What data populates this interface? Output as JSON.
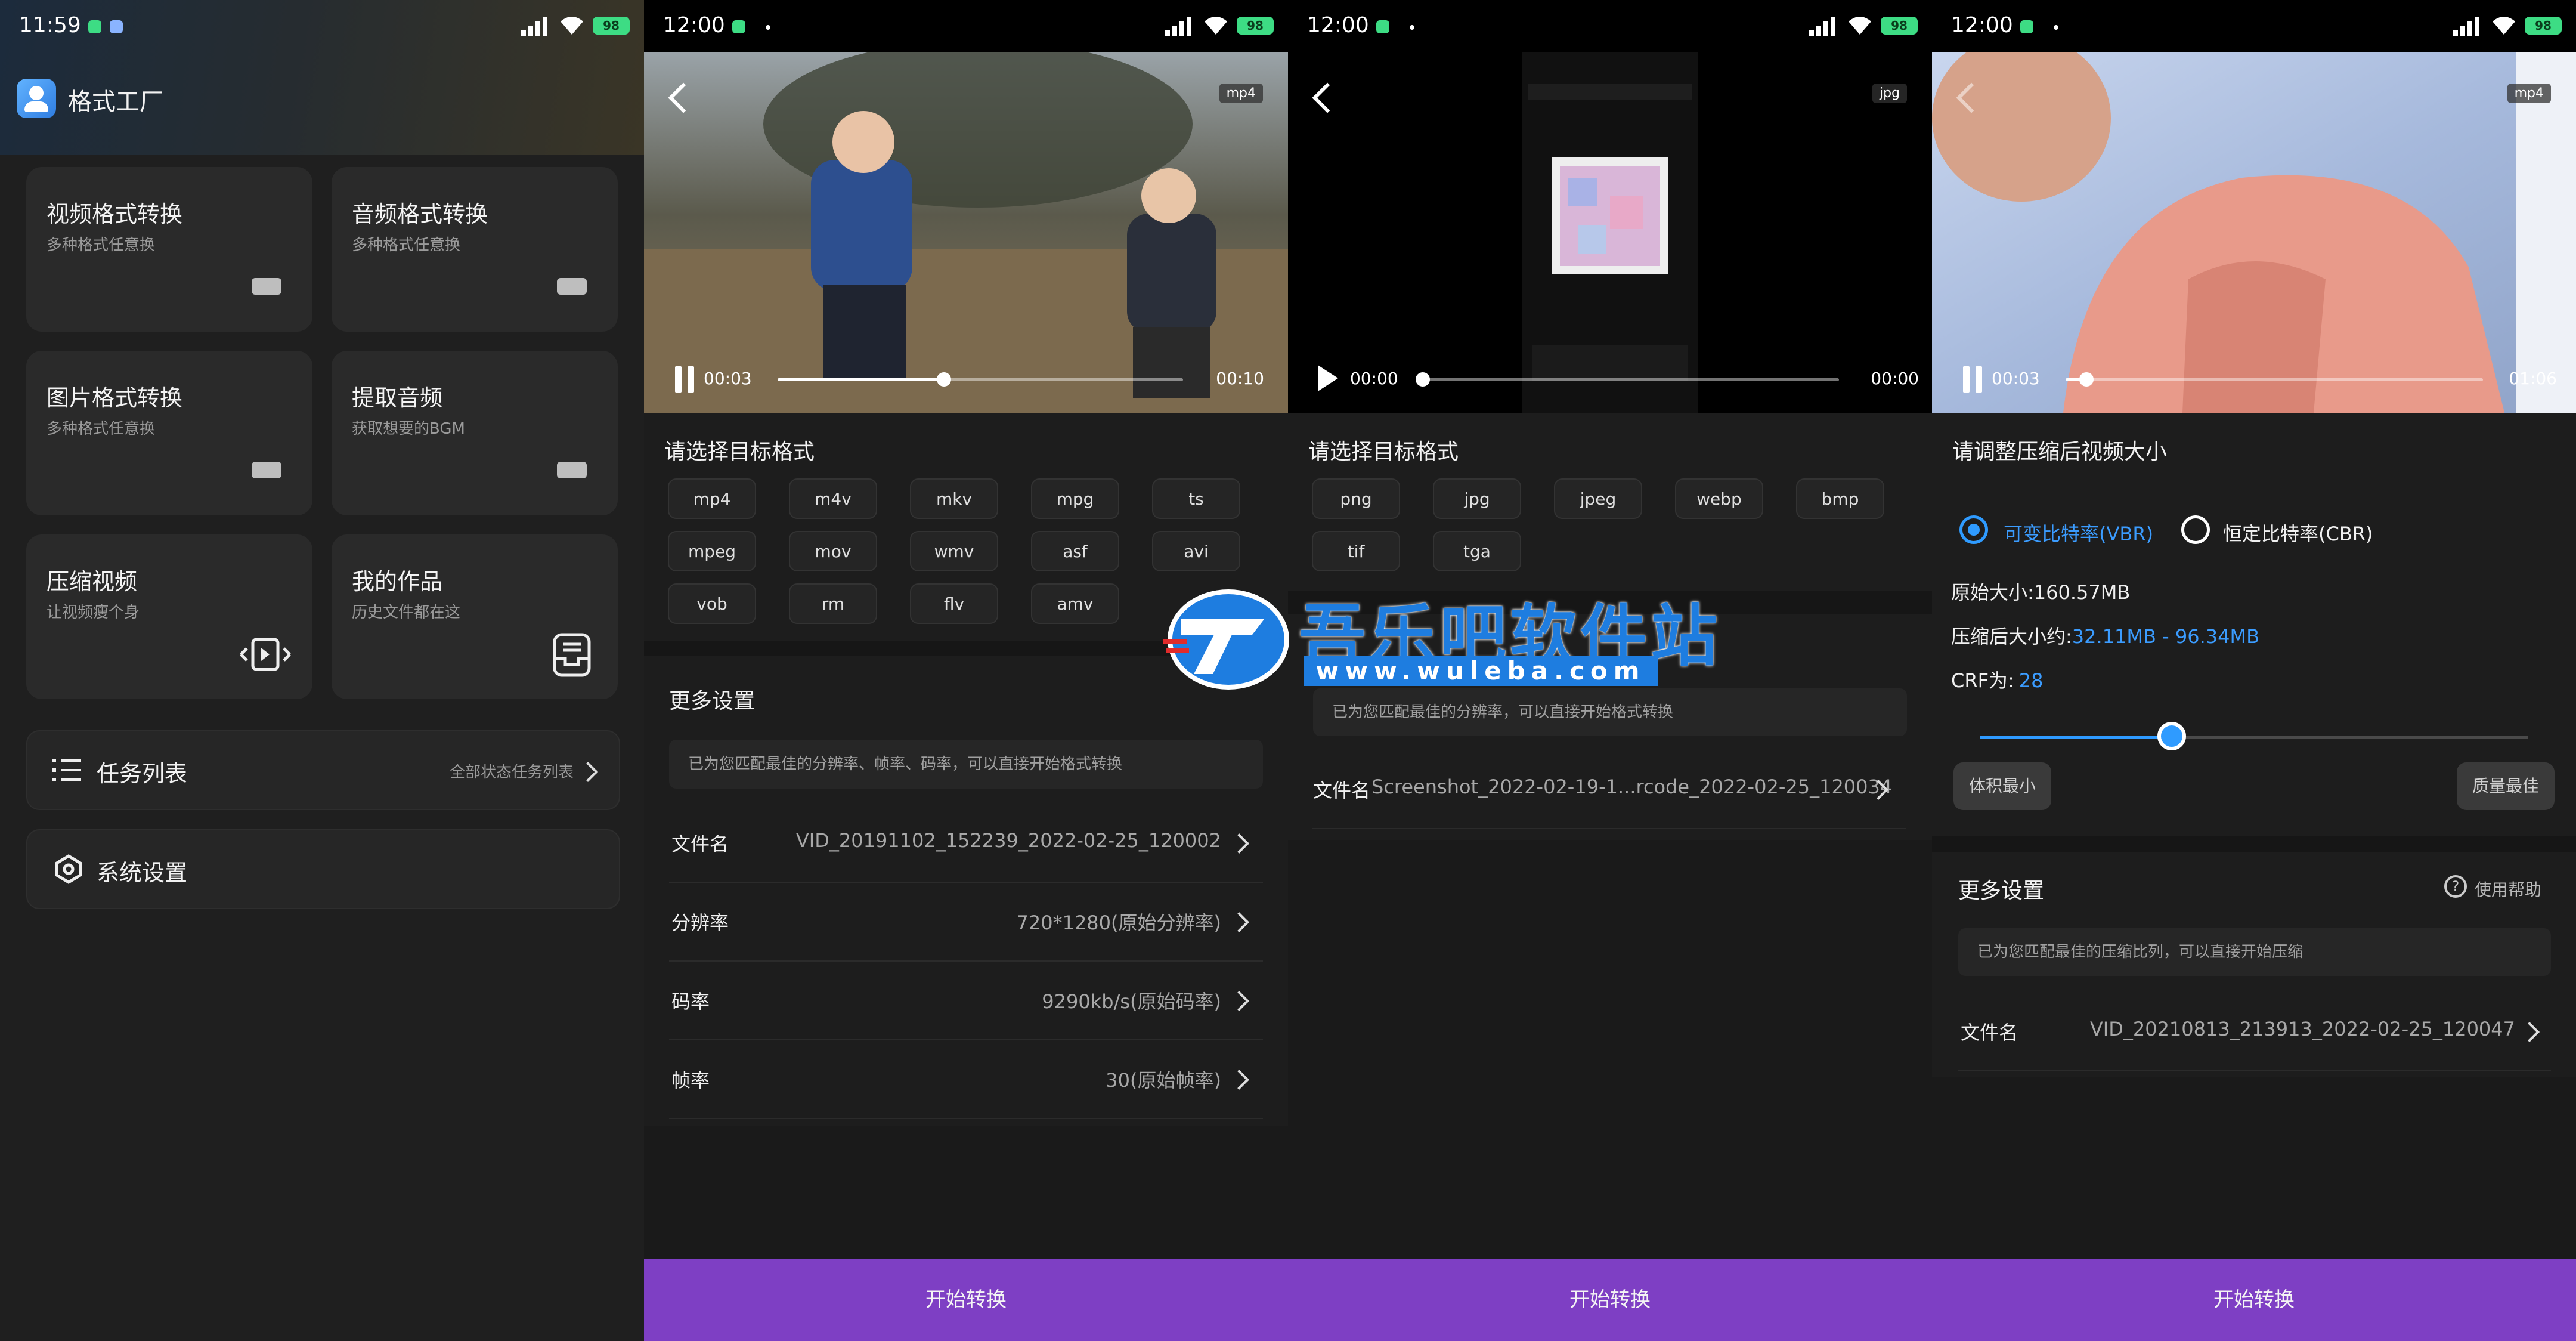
{
  "panel1": {
    "time": "11:59",
    "battery": "98",
    "app_title": "格式工厂",
    "cards": [
      {
        "title": "视频格式转换",
        "sub": "多种格式任意换"
      },
      {
        "title": "音频格式转换",
        "sub": "多种格式任意换"
      },
      {
        "title": "图片格式转换",
        "sub": "多种格式任意换"
      },
      {
        "title": "提取音频",
        "sub": "获取想要的BGM"
      },
      {
        "title": "压缩视频",
        "sub": "让视频瘦个身"
      },
      {
        "title": "我的作品",
        "sub": "历史文件都在这"
      }
    ],
    "task_list": {
      "label": "任务列表",
      "right": "全部状态任务列表"
    },
    "settings": {
      "label": "系统设置"
    }
  },
  "panel2": {
    "time": "12:00",
    "battery": "98",
    "badge": "mp4",
    "time_current": "00:03",
    "time_total": "00:10",
    "progress": 0.41,
    "section_title": "请选择目标格式",
    "formats": [
      "mp4",
      "m4v",
      "mkv",
      "mpg",
      "ts",
      "mpeg",
      "mov",
      "wmv",
      "asf",
      "avi",
      "vob",
      "rm",
      "flv",
      "amv"
    ],
    "more_settings": "更多设置",
    "hint": "已为您匹配最佳的分辨率、帧率、码率，可以直接开始格式转换",
    "rows": [
      {
        "label": "文件名",
        "value": "VID_20191102_152239_2022-02-25_120002"
      },
      {
        "label": "分辨率",
        "value": "720*1280(原始分辨率)"
      },
      {
        "label": "码率",
        "value": "9290kb/s(原始码率)"
      },
      {
        "label": "帧率",
        "value": "30(原始帧率)"
      }
    ],
    "button": "开始转换"
  },
  "panel3": {
    "time": "12:00",
    "battery": "98",
    "badge": "jpg",
    "time_current": "00:00",
    "time_total": "00:00",
    "section_title": "请选择目标格式",
    "formats": [
      "png",
      "jpg",
      "jpeg",
      "webp",
      "bmp",
      "tif",
      "tga"
    ],
    "hint": "已为您匹配最佳的分辨率，可以直接开始格式转换",
    "rows": [
      {
        "label": "文件名",
        "value": "Screenshot_2022-02-19-1...rcode_2022-02-25_120034"
      }
    ],
    "button": "开始转换"
  },
  "panel4": {
    "time": "12:00",
    "battery": "98",
    "badge": "mp4",
    "time_current": "00:03",
    "time_total": "01:06",
    "progress": 0.05,
    "section_title": "请调整压缩后视频大小",
    "vbr": "可变比特率(VBR)",
    "cbr": "恒定比特率(CBR)",
    "original_size_label": "原始大小:160.57MB",
    "compressed_label": "压缩后大小约:",
    "compressed_value": "32.11MB - 96.34MB",
    "crf_label": "CRF为:",
    "crf_value": "28",
    "crf_level": 0.35,
    "min_label": "体积最小",
    "max_label": "质量最佳",
    "more_settings": "更多设置",
    "help": "使用帮助",
    "hint": "已为您匹配最佳的压缩比列，可以直接开始压缩",
    "rows": [
      {
        "label": "文件名",
        "value": "VID_20210813_213913_2022-02-25_120047"
      }
    ],
    "button": "开始转换"
  },
  "watermark": {
    "title": "吾乐吧软件站",
    "url": "www.wuleba.com"
  },
  "colors": {
    "accent": "#7e3fc4",
    "blue": "#2f9bff",
    "battery": "#3ddc84",
    "background": "#1d1d1d"
  }
}
